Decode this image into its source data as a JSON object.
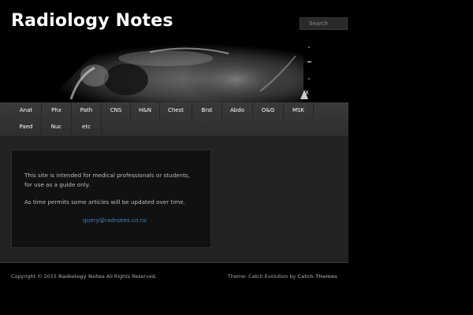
{
  "site": {
    "title": "Radiology Notes"
  },
  "search": {
    "placeholder": "Search"
  },
  "nav": {
    "row1": [
      {
        "label": "Anat"
      },
      {
        "label": "Phx"
      },
      {
        "label": "Path"
      },
      {
        "label": "CNS"
      },
      {
        "label": "H&N"
      },
      {
        "label": "Chest"
      },
      {
        "label": "Brst"
      },
      {
        "label": "Abdo"
      },
      {
        "label": "O&G"
      },
      {
        "label": "MSK"
      }
    ],
    "row2": [
      {
        "label": "Paed"
      },
      {
        "label": "Nuc"
      },
      {
        "label": "etc"
      }
    ]
  },
  "content": {
    "paragraph1": "This site is intended for medical professionals or students, for use as a guide only.",
    "paragraph2": "As time permits some articles will be updated over time.",
    "email": "query@radnotes.co.nz"
  },
  "footer": {
    "copyright_prefix": "Copyright © 2015",
    "site_link": "Radiology Notes",
    "rights": "All Rights Reserved.",
    "theme_prefix": "Theme: Catch Evolution by",
    "theme_author": "Catch Themes"
  },
  "colors": {
    "background": "#000000",
    "nav_bar": "#333333",
    "content_area": "#222222",
    "link": "#3a84c4"
  }
}
